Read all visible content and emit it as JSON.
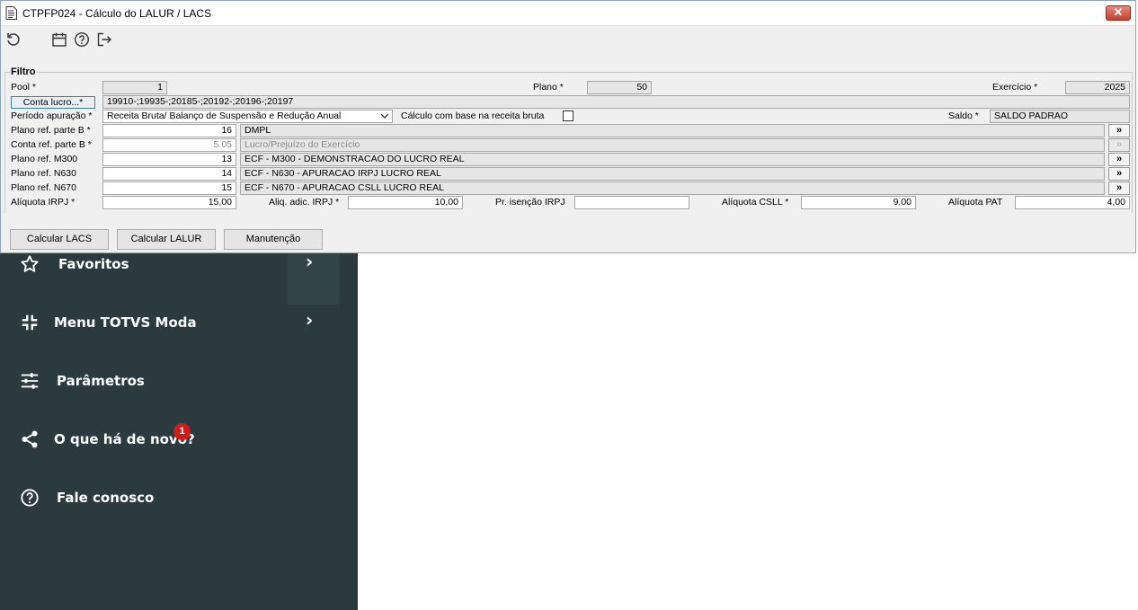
{
  "window": {
    "title": "CTPFP024 - Cálculo do LALUR / LACS",
    "close_label": "✕"
  },
  "toolbar": {
    "icons": [
      "refresh-icon",
      "calendar-icon",
      "help-icon",
      "exit-icon"
    ]
  },
  "filter": {
    "legend": "Filtro",
    "pool": {
      "label": "Pool *",
      "value": "1"
    },
    "plano": {
      "label": "Plano *",
      "value": "50"
    },
    "exercicio": {
      "label": "Exercício *",
      "value": "2025"
    },
    "conta_lucro": {
      "button": "Conta lucro...*",
      "value": "19910-;19935-;20185-;20192-;20196-;20197"
    },
    "periodo": {
      "label": "Período apuração *",
      "value": "Receita Bruta/ Balanço de Suspensão e Redução Anual"
    },
    "calculo_receita": {
      "label": "Cálculo com base na receita bruta",
      "checked": false
    },
    "saldo": {
      "label": "Saldo *",
      "value": "SALDO PADRAO"
    },
    "plano_parte_b": {
      "label": "Plano ref. parte B *",
      "value": "16",
      "desc": "DMPL"
    },
    "conta_parte_b": {
      "label": "Conta ref. parte B *",
      "value": "5.05",
      "desc": "Lucro/Prejuízo do Exercício"
    },
    "plano_m300": {
      "label": "Plano ref. M300",
      "value": "13",
      "desc": "ECF - M300 - DEMONSTRACAO DO LUCRO REAL"
    },
    "plano_n630": {
      "label": "Plano ref. N630",
      "value": "14",
      "desc": "ECF - N630 - APURACAO IRPJ LUCRO REAL"
    },
    "plano_n670": {
      "label": "Plano ref. N670",
      "value": "15",
      "desc": "ECF - N670 - APURACAO CSLL LUCRO REAL"
    },
    "aliquota_irpj": {
      "label": "Alíquota IRPJ *",
      "value": "15,00"
    },
    "aliq_adic_irpj": {
      "label": "Aliq. adic. IRPJ *",
      "value": "10,00"
    },
    "pr_isencao_irpj": {
      "label": "Pr. isenção IRPJ",
      "value": ""
    },
    "aliquota_csll": {
      "label": "Alíquota CSLL *",
      "value": "9,00"
    },
    "aliquota_pat": {
      "label": "Alíquota PAT",
      "value": "4,00"
    },
    "lookup_label": "»"
  },
  "actions": {
    "calc_lacs": "Calcular LACS",
    "calc_lalur": "Calcular LALUR",
    "manutencao": "Manutenção"
  },
  "sidebar": {
    "items": [
      {
        "label": "Favoritos",
        "icon": "star-icon"
      },
      {
        "label": "Menu TOTVS Moda",
        "icon": "collapse-icon"
      },
      {
        "label": "Parâmetros",
        "icon": "sliders-icon"
      },
      {
        "label": "O que há de novo?",
        "icon": "share-icon",
        "badge": "1"
      },
      {
        "label": "Fale conosco",
        "icon": "question-circle-icon"
      }
    ],
    "chevron": "›"
  },
  "colors": {
    "sidebar_bg": "#2b3b3d",
    "badge": "#d11a1a",
    "dialog_bg": "#f0f0f0"
  }
}
